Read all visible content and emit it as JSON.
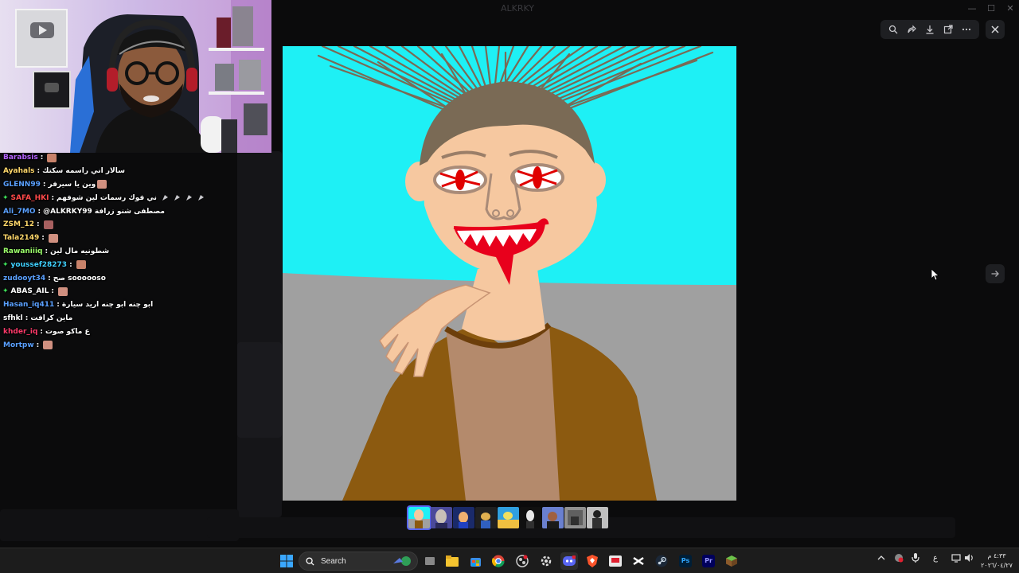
{
  "window": {
    "title": "ALKRKY",
    "controls": [
      "minimize",
      "maximize",
      "close"
    ]
  },
  "viewer": {
    "toolbar_icons": [
      "zoom-icon",
      "forward-icon",
      "download-icon",
      "open-external-icon",
      "more-icon"
    ],
    "close_icon": "close-icon",
    "next_icon": "arrow-right-icon",
    "thumbnail_count": 9,
    "active_thumbnail": 0
  },
  "chat": {
    "messages": [
      {
        "user": "Barabsis",
        "color": "#b563ff",
        "badge": "",
        "text": "",
        "emote": true
      },
      {
        "user": "Ayahals",
        "color": "#ffd86b",
        "badge": "",
        "text": "سالار اني راسمه سكتك",
        "emote": false
      },
      {
        "user": "GLENN99",
        "color": "#5aa0ff",
        "badge": "",
        "text": "وين يا سيرفر",
        "emote": true
      },
      {
        "user": "SAFA_HKI",
        "color": "#ff4a4a",
        "badge": "✦",
        "text": "ني فوك رسمات لين شوفهم",
        "emote": false,
        "drops": 4
      },
      {
        "user": "Ali_7MO",
        "color": "#5aa0ff",
        "badge": "",
        "text": "@ALKRKY99 مصطفى شنو زرافة",
        "emote": false
      },
      {
        "user": "ZSM_12",
        "color": "#ffd86b",
        "badge": "",
        "text": "",
        "emote": true
      },
      {
        "user": "Tala2149",
        "color": "#ffd86b",
        "badge": "",
        "text": "",
        "emote": true
      },
      {
        "user": "Rawaniiiq",
        "color": "#9cff6b",
        "badge": "",
        "text": "شطونيه مال لين",
        "emote": false
      },
      {
        "user": "youssef28273",
        "color": "#3fd0ff",
        "badge": "✦",
        "text": "",
        "emote": true
      },
      {
        "user": "zudooyt34",
        "color": "#5aa0ff",
        "badge": "",
        "text": "صح soooooso",
        "emote": false
      },
      {
        "user": "ABAS_AIL",
        "color": "#ffffff",
        "badge": "✦",
        "text": "",
        "emote": true
      },
      {
        "user": "Hasan_iq411",
        "color": "#5aa0ff",
        "badge": "",
        "text": "ابو چنه ابو چنه اريد سيارة",
        "emote": false
      },
      {
        "user": "sfhkl",
        "color": "#ffffff",
        "badge": "",
        "text": "ماين كرافت",
        "emote": false
      },
      {
        "user": "khder_iq",
        "color": "#ff3a6a",
        "badge": "",
        "text": "ع ماكو صوت",
        "emote": false
      },
      {
        "user": "Mortpw",
        "color": "#5aa0ff",
        "badge": "",
        "text": "",
        "emote": true
      }
    ]
  },
  "taskbar": {
    "search_label": "Search",
    "apps": [
      "file-explorer-icon",
      "task-view-icon",
      "folder-icon",
      "store-icon",
      "chrome-icon",
      "obs-icon",
      "settings-icon",
      "discord-icon",
      "brave-icon",
      "media-icon",
      "capcut-icon",
      "steam-icon",
      "photoshop-icon",
      "premiere-icon",
      "minecraft-icon"
    ],
    "photoshop_label": "Ps",
    "premiere_label": "Pr",
    "language": "ع",
    "time": "٤:٣٣ م",
    "date": "٢٠٢٦/٠٤/٢٧"
  }
}
